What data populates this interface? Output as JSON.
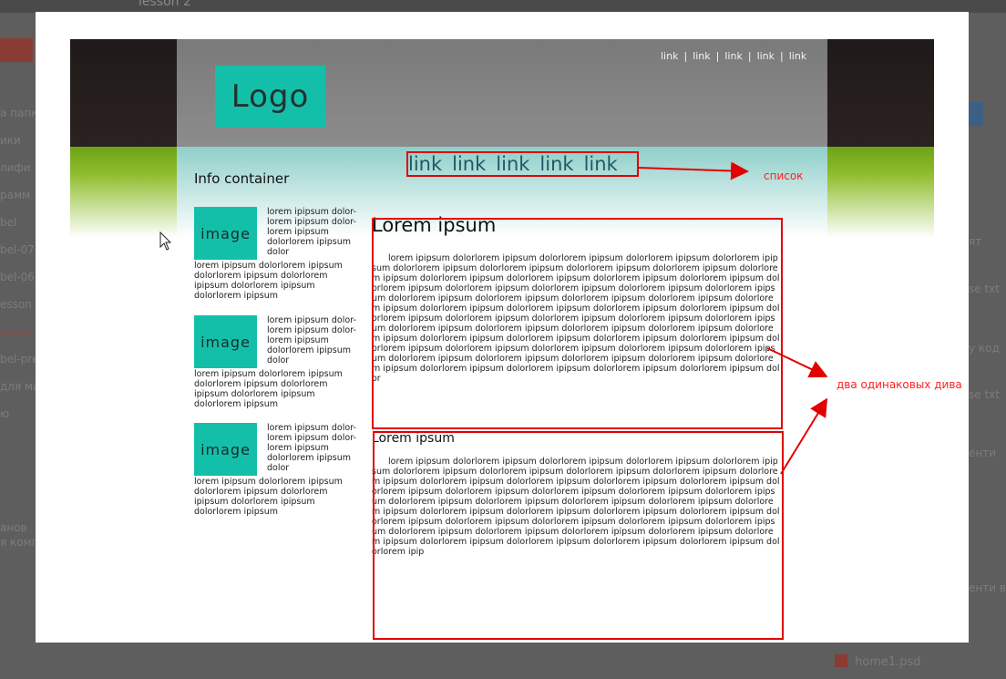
{
  "background": {
    "title": "lesson 2",
    "left_items": [
      "а папк",
      "ики",
      "лифи",
      "рамм",
      "bel",
      "bel-07",
      "bel-06",
      "esson",
      "esson",
      "bel-pre",
      "для ма",
      "ю",
      "анов",
      "я комп"
    ],
    "right_items": [
      "ят",
      "se txt",
      "у код",
      "se txt",
      "енти",
      "енти в с"
    ],
    "file_name": "home1.psd"
  },
  "mockup": {
    "logo": "Logo",
    "top_links": [
      "link",
      "link",
      "link",
      "link",
      "link"
    ],
    "top_link_separator": "|",
    "nav_links": [
      "link",
      "link",
      "link",
      "link",
      "link"
    ],
    "info_title": "Info container",
    "info_items": [
      {
        "image_label": "image",
        "side_text": "lorem ipipsum dolor-lorem ipipsum dolor-lorem ipipsum dolorlorem ipipsum dolor",
        "bottom_text": "lorem ipipsum dolorlorem ipipsum dolorlorem ipipsum dolorlorem ipipsum dolorlorem ipipsum dolorlorem ipipsum"
      },
      {
        "image_label": "image",
        "side_text": "lorem ipipsum dolor-lorem ipipsum dolor-lorem ipipsum dolorlorem ipipsum dolor",
        "bottom_text": "lorem ipipsum dolorlorem ipipsum dolorlorem ipipsum dolorlorem ipipsum dolorlorem ipipsum dolorlorem ipipsum"
      },
      {
        "image_label": "image",
        "side_text": "lorem ipipsum dolor-lorem ipipsum dolor-lorem ipipsum dolorlorem ipipsum dolor",
        "bottom_text": "lorem ipipsum dolorlorem ipipsum dolorlorem ipipsum dolorlorem ipipsum dolorlorem ipipsum dolorlorem ipipsum"
      }
    ],
    "content_blocks": [
      {
        "title": "Lorem ipsum",
        "text": "lorem ipipsum dolorlorem ipipsum dolorlorem ipipsum dolorlorem ipipsum dolorlorem ipipsum dolorlorem ipipsum dolorlorem ipipsum dolorlorem ipipsum dolorlorem ipipsum dolorlorem ipipsum dolorlorem ipipsum dolorlorem ipipsum dolorlorem ipipsum dolorlorem ipipsum dolorlorem ipipsum dolorlorem ipipsum dolorlorem ipipsum dolorlorem ipipsum dolorlorem ipipsum dolorlorem ipipsum dolorlorem ipipsum dolorlorem ipipsum dolorlorem ipipsum dolorlorem ipipsum dolorlorem ipipsum dolorlorem ipipsum dolorlorem ipipsum dolorlorem ipipsum dolorlorem ipipsum dolorlorem ipipsum dolorlorem ipipsum dolorlorem ipipsum dolorlorem ipipsum dolorlorem ipipsum dolorlorem ipipsum dolorlorem ipipsum dolorlorem ipipsum dolorlorem ipipsum dolorlorem ipipsum dolorlorem ipipsum dolorlorem ipipsum dolorlorem ipipsum dolorlorem ipipsum dolorlorem ipipsum dolorlorem ipipsum dolorlorem ipipsum dolorlorem ipipsum dolorlorem ipipsum dolorlorem ipipsum dolorlorem ipipsum dolorlorem ipipsum dolorlorem ipipsum dolorlorem ipipsum dolorlorem ipipsum dolorlorem ipipsum dolorlorem ipipsum dolor"
      },
      {
        "title": "Lorem ipsum",
        "text": "lorem ipipsum dolorlorem ipipsum dolorlorem ipipsum dolorlorem ipipsum dolorlorem ipipsum dolorlorem ipipsum dolorlorem ipipsum dolorlorem ipipsum dolorlorem ipipsum dolorlorem ipipsum dolorlorem ipipsum dolorlorem ipipsum dolorlorem ipipsum dolorlorem ipipsum dolorlorem ipipsum dolorlorem ipipsum dolorlorem ipipsum dolorlorem ipipsum dolorlorem ipipsum dolorlorem ipipsum dolorlorem ipipsum dolorlorem ipipsum dolorlorem ipipsum dolorlorem ipipsum dolorlorem ipipsum dolorlorem ipipsum dolorlorem ipipsum dolorlorem ipipsum dolorlorem ipipsum dolorlorem ipipsum dolorlorem ipipsum dolorlorem ipipsum dolorlorem ipipsum dolorlorem ipipsum dolorlorem ipipsum dolorlorem ipipsum dolorlorem ipipsum dolorlorem ipipsum dolorlorem ipipsum dolorlorem ipipsum dolorlorem ipipsum dolorlorem ipipsum dolorlorem ipip"
      }
    ]
  },
  "annotations": {
    "list_label": "список",
    "divs_label": "два одинаковых дива",
    "color": "#e30000"
  },
  "colors": {
    "logo_bg": "#14bfaa",
    "header_gray": "#808080",
    "green": "#7aae1f",
    "dark": "#231d1c"
  }
}
